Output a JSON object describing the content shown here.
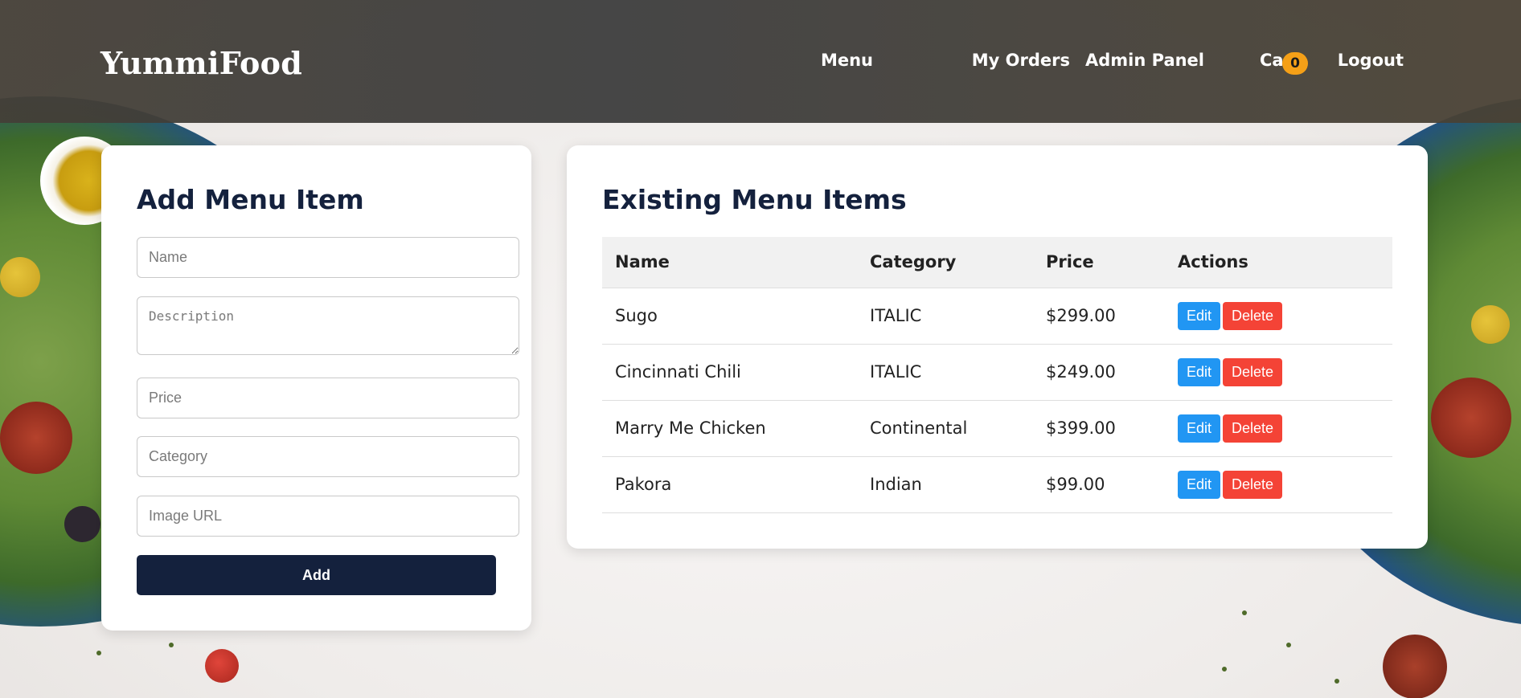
{
  "header": {
    "brand": "YummiFood",
    "nav": [
      {
        "label": "Menu"
      },
      {
        "label": "My Orders"
      },
      {
        "label": "Admin Panel"
      },
      {
        "label": "Cart"
      },
      {
        "label": "Logout"
      }
    ],
    "cart_count": "0",
    "colors": {
      "bar": "#3c3c3c",
      "badge": "#f5a017"
    }
  },
  "form": {
    "title": "Add Menu Item",
    "fields": {
      "name": {
        "placeholder": "Name",
        "value": ""
      },
      "description": {
        "placeholder": "Description",
        "value": ""
      },
      "price": {
        "placeholder": "Price",
        "value": ""
      },
      "category": {
        "placeholder": "Category",
        "value": ""
      },
      "image_url": {
        "placeholder": "Image URL",
        "value": ""
      }
    },
    "submit_label": "Add",
    "colors": {
      "button": "#14213d"
    }
  },
  "table": {
    "title": "Existing Menu Items",
    "columns": [
      "Name",
      "Category",
      "Price",
      "Actions"
    ],
    "rows": [
      {
        "name": "Sugo",
        "category": "ITALIC",
        "price": "$299.00",
        "edit": "Edit",
        "delete": "Delete"
      },
      {
        "name": "Cincinnati Chili",
        "category": "ITALIC",
        "price": "$249.00",
        "edit": "Edit",
        "delete": "Delete"
      },
      {
        "name": "Marry Me Chicken",
        "category": "Continental",
        "price": "$399.00",
        "edit": "Edit",
        "delete": "Delete"
      },
      {
        "name": "Pakora",
        "category": "Indian",
        "price": "$99.00",
        "edit": "Edit",
        "delete": "Delete"
      }
    ],
    "colors": {
      "edit": "#2196f3",
      "delete": "#f44336"
    }
  }
}
